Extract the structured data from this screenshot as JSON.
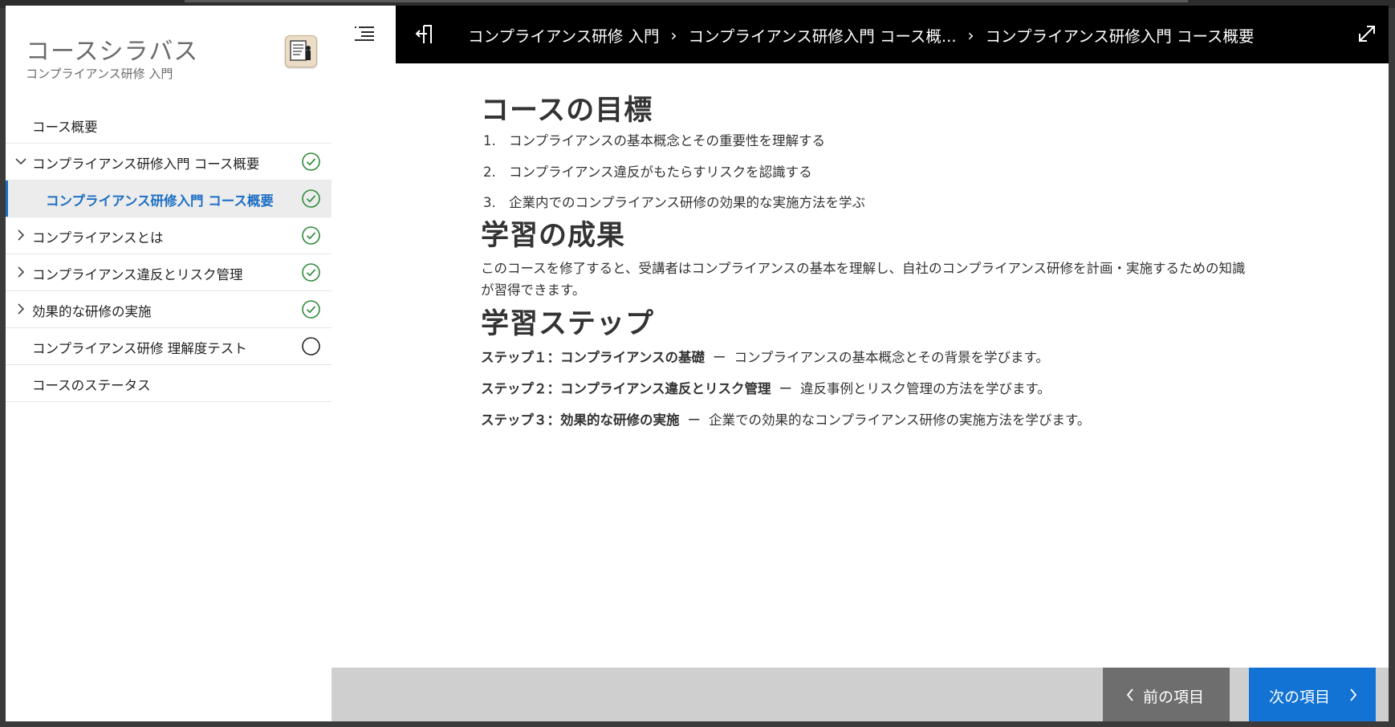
{
  "sidebar": {
    "title": "コースシラバス",
    "subtitle": "コンプライアンス研修 入門",
    "items": [
      {
        "label": "コース概要",
        "status": "none"
      },
      {
        "label": "コンプライアンス研修入門 コース概要",
        "status": "complete",
        "chevron": "down"
      },
      {
        "label": "コンプライアンス研修入門 コース概要",
        "status": "complete",
        "active": true
      },
      {
        "label": "コンプライアンスとは",
        "status": "complete",
        "chevron": "right"
      },
      {
        "label": "コンプライアンス違反とリスク管理",
        "status": "complete",
        "chevron": "right"
      },
      {
        "label": "効果的な研修の実施",
        "status": "complete",
        "chevron": "right"
      },
      {
        "label": "コンプライアンス研修 理解度テスト",
        "status": "incomplete"
      },
      {
        "label": "コースのステータス",
        "status": "none"
      }
    ]
  },
  "header": {
    "breadcrumbs": [
      "コンプライアンス研修 入門",
      "コンプライアンス研修入門 コース概...",
      "コンプライアンス研修入門 コース概要"
    ],
    "separator": "›"
  },
  "content": {
    "goals_heading": "コースの目標",
    "goals": [
      {
        "num": "1.",
        "text": "コンプライアンスの基本概念とその重要性を理解する"
      },
      {
        "num": "2.",
        "text": "コンプライアンス違反がもたらすリスクを認識する"
      },
      {
        "num": "3.",
        "text": "企業内でのコンプライアンス研修の効果的な実施方法を学ぶ"
      }
    ],
    "outcome_heading": "学習の成果",
    "outcome_text": "このコースを修了すると、受講者はコンプライアンスの基本を理解し、自社のコンプライアンス研修を計画・実施するための知識が習得できます。",
    "steps_heading": "学習ステップ",
    "steps": [
      {
        "title": "ステップ１：コンプライアンスの基礎",
        "dash": "ー",
        "desc": "コンプライアンスの基本概念とその背景を学びます。"
      },
      {
        "title": "ステップ２：コンプライアンス違反とリスク管理",
        "dash": "ー",
        "desc": "違反事例とリスク管理の方法を学びます。"
      },
      {
        "title": "ステップ３：効果的な研修の実施",
        "dash": "ー",
        "desc": "企業での効果的なコンプライアンス研修の実施方法を学びます。"
      }
    ]
  },
  "footer": {
    "prev_label": "前の項目",
    "next_label": "次の項目"
  },
  "colors": {
    "accent": "#1d6fc4",
    "next_button": "#1273d4",
    "prev_button": "#6e6e6e",
    "complete": "#2e8b3a",
    "header_bg": "#000000"
  },
  "icons": {
    "menu": "menu-list-icon",
    "exit": "exit-icon",
    "expand": "expand-icon",
    "complete": "check-circle-icon",
    "incomplete": "empty-circle-icon"
  }
}
